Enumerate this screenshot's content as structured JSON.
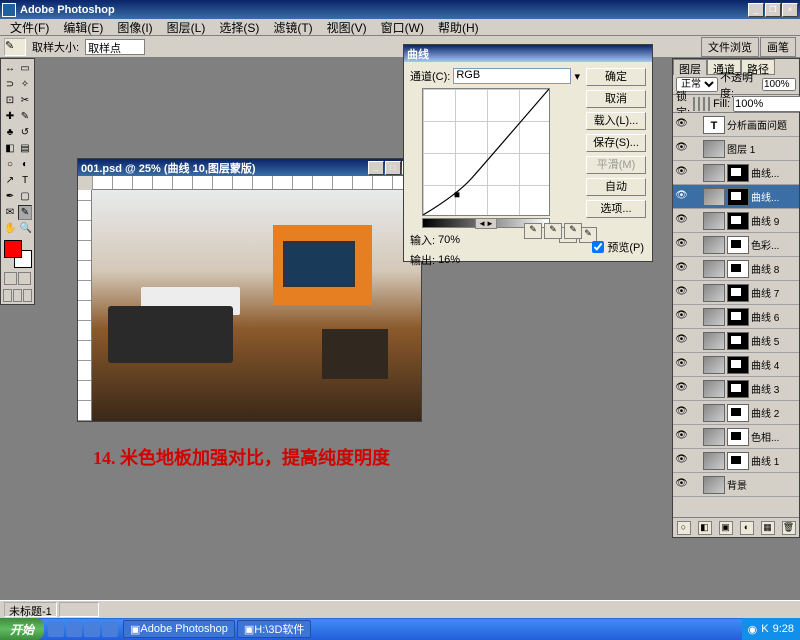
{
  "app": {
    "title": "Adobe Photoshop"
  },
  "menu": [
    "文件(F)",
    "编辑(E)",
    "图像(I)",
    "图层(L)",
    "选择(S)",
    "滤镜(T)",
    "视图(V)",
    "窗口(W)",
    "帮助(H)"
  ],
  "optbar": {
    "label": "取样大小:",
    "sample": "取样点",
    "tabs": [
      "文件浏览",
      "画笔"
    ]
  },
  "doc": {
    "title": "001.psd @ 25% (曲线 10,图层蒙版)"
  },
  "caption": "14. 米色地板加强对比，提高纯度明度",
  "curves": {
    "title": "曲线",
    "channelLabel": "通道(C):",
    "channel": "RGB",
    "inputLabel": "输入:",
    "input": "70%",
    "outputLabel": "输出:",
    "output": "16%",
    "buttons": {
      "ok": "确定",
      "cancel": "取消",
      "load": "载入(L)...",
      "save": "保存(S)...",
      "smooth": "平滑(M)",
      "auto": "自动",
      "options": "选项..."
    },
    "preview": "预览(P)"
  },
  "chart_data": {
    "type": "line",
    "title": "曲线",
    "x": [
      0,
      70,
      255
    ],
    "y": [
      0,
      41,
      255
    ],
    "xlabel": "输入",
    "ylabel": "输出",
    "xlim": [
      0,
      255
    ],
    "ylim": [
      0,
      255
    ],
    "point": {
      "x": 70,
      "y": 41
    }
  },
  "layers": {
    "tabs": [
      "图层",
      "通道",
      "路径"
    ],
    "blend": "正常",
    "opacityLabel": "不透明度:",
    "opacity": "100%",
    "lockLabel": "锁定:",
    "fillLabel": "Fill:",
    "fill": "100%",
    "items": [
      {
        "name": "分析画面问题",
        "type": "text",
        "vis": true
      },
      {
        "name": "图层 1",
        "type": "raster",
        "vis": true
      },
      {
        "name": "曲线...",
        "type": "adj",
        "mask": "b",
        "vis": true
      },
      {
        "name": "曲线...",
        "type": "adj",
        "mask": "b",
        "vis": true,
        "sel": true
      },
      {
        "name": "曲线 9",
        "type": "adj",
        "mask": "b",
        "vis": true
      },
      {
        "name": "色彩...",
        "type": "adj",
        "mask": "w",
        "vis": true
      },
      {
        "name": "曲线 8",
        "type": "adj",
        "mask": "w",
        "vis": true
      },
      {
        "name": "曲线 7",
        "type": "adj",
        "mask": "b",
        "vis": true
      },
      {
        "name": "曲线 6",
        "type": "adj",
        "mask": "b",
        "vis": true
      },
      {
        "name": "曲线 5",
        "type": "adj",
        "mask": "b",
        "vis": true
      },
      {
        "name": "曲线 4",
        "type": "adj",
        "mask": "b",
        "vis": true
      },
      {
        "name": "曲线 3",
        "type": "adj",
        "mask": "b",
        "vis": true
      },
      {
        "name": "曲线 2",
        "type": "adj",
        "mask": "w",
        "vis": true
      },
      {
        "name": "色相...",
        "type": "adj",
        "mask": "w",
        "vis": true
      },
      {
        "name": "曲线 1",
        "type": "adj",
        "mask": "w",
        "vis": true
      },
      {
        "name": "背景",
        "type": "bg",
        "vis": true
      }
    ]
  },
  "status": {
    "doc": "未标题-1"
  },
  "taskbar": {
    "start": "开始",
    "tasks": [
      "Adobe Photoshop",
      "H:\\3D软件"
    ],
    "time": "9:28"
  }
}
